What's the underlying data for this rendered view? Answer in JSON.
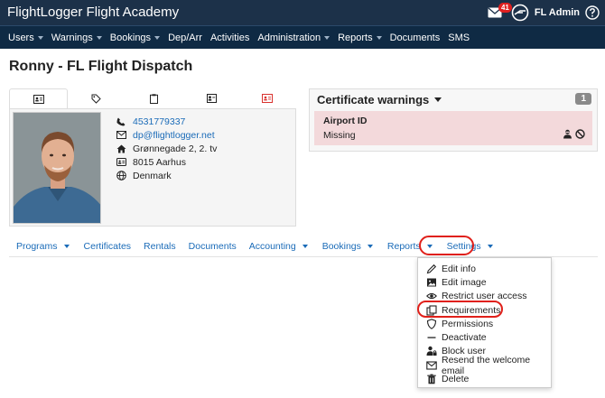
{
  "app": {
    "brand": "FlightLogger Flight Academy",
    "mail_count": "41",
    "user_label": "FL Admin"
  },
  "nav": [
    {
      "label": "Users",
      "dropdown": true
    },
    {
      "label": "Warnings",
      "dropdown": true
    },
    {
      "label": "Bookings",
      "dropdown": true
    },
    {
      "label": "Dep/Arr",
      "dropdown": false
    },
    {
      "label": "Activities",
      "dropdown": false
    },
    {
      "label": "Administration",
      "dropdown": true
    },
    {
      "label": "Reports",
      "dropdown": true
    },
    {
      "label": "Documents",
      "dropdown": false
    },
    {
      "label": "SMS",
      "dropdown": false
    }
  ],
  "page": {
    "title": "Ronny - FL Flight Dispatch"
  },
  "profile": {
    "phone": "4531779337",
    "email": "dp@flightlogger.net",
    "address": "Grønnegade 2, 2. tv",
    "city": "8015 Aarhus",
    "country": "Denmark"
  },
  "cert_warnings": {
    "title": "Certificate warnings",
    "count": "1",
    "item_title": "Airport ID",
    "item_status": "Missing"
  },
  "subnav": [
    {
      "label": "Programs",
      "dropdown": true
    },
    {
      "label": "Certificates",
      "dropdown": false
    },
    {
      "label": "Rentals",
      "dropdown": false
    },
    {
      "label": "Documents",
      "dropdown": false
    },
    {
      "label": "Accounting",
      "dropdown": true
    },
    {
      "label": "Bookings",
      "dropdown": true
    },
    {
      "label": "Reports",
      "dropdown": true
    },
    {
      "label": "Settings",
      "dropdown": true
    }
  ],
  "settings_menu": [
    {
      "label": "Edit info",
      "icon": "pencil-icon"
    },
    {
      "label": "Edit image",
      "icon": "image-icon"
    },
    {
      "label": "Restrict user access",
      "icon": "eye-icon"
    },
    {
      "label": "Requirements",
      "icon": "copy-icon"
    },
    {
      "label": "Permissions",
      "icon": "shield-icon"
    },
    {
      "label": "Deactivate",
      "icon": "minus-icon"
    },
    {
      "label": "Block user",
      "icon": "user-lock-icon"
    },
    {
      "label": "Resend the welcome email",
      "icon": "envelope-icon"
    },
    {
      "label": "Delete",
      "icon": "trash-icon"
    }
  ],
  "colors": {
    "topbar": "#1c3149",
    "navbar": "#0f2a44",
    "link": "#1a6bb8",
    "highlight_ring": "#e0201a",
    "warning_row": "#f3d9db"
  }
}
